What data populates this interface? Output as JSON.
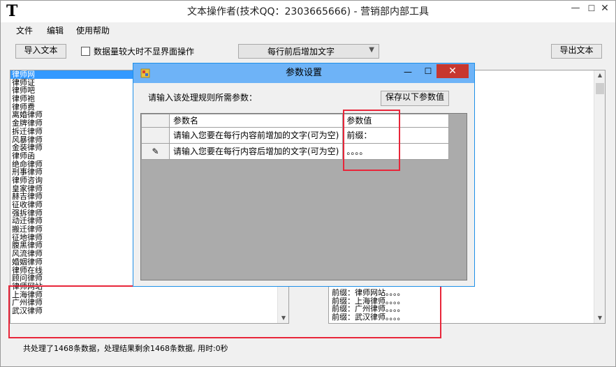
{
  "window": {
    "icon_glyph": "T",
    "title": "文本操作者(技术QQ：2303665666) - 营销部内部工具",
    "controls": {
      "minimize": "—",
      "maximize": "☐",
      "close": "✕"
    }
  },
  "menu": [
    "文件",
    "编辑",
    "使用帮助"
  ],
  "toolbar": {
    "import_label": "导入文本",
    "checkbox_label": "数据量较大时不显界面操作",
    "operation_selected": "每行前后增加文字",
    "export_label": "导出文本"
  },
  "left_list": {
    "items": [
      "律师网",
      "律师证",
      "律师吧",
      "律师袍",
      "律师费",
      "离婚律师",
      "金牌律师",
      "拆迁律师",
      "风暴律师",
      "金装律师",
      "律师函",
      "绝命律师",
      "刑事律师",
      "律师咨询",
      "皇家律师",
      "赫吉律师",
      "征收律师",
      "强拆律师",
      "动迁律师",
      "搬迁律师",
      "征地律师",
      "腹黑律师",
      "风流律师",
      "婚姻律师",
      "律师在线",
      "顾问律师"
    ],
    "highlighted_items": [
      "律师网站",
      "上海律师",
      "广州律师",
      "武汉律师"
    ]
  },
  "right_list": {
    "items": [
      "前缀：律师网站。。。。",
      "前缀：上海律师。。。。",
      "前缀：广州律师。。。。",
      "前缀：武汉律师。。。。"
    ]
  },
  "status": "共处理了1468条数据，处理结果剩余1468条数据, 用时:0秒",
  "dialog": {
    "title": "参数设置",
    "controls": {
      "minimize": "—",
      "maximize": "☐",
      "close": "✕"
    },
    "prompt": "请输入该处理规则所需参数：",
    "save_label": "保存以下参数值",
    "grid": {
      "headers": [
        "参数名",
        "参数值"
      ],
      "rows": [
        {
          "name": "请输入您要在每行内容前增加的文字(可为空)",
          "value": "前缀：",
          "row_marker": ""
        },
        {
          "name": "请输入您要在每行内容后增加的文字(可为空)",
          "value": "。。。。",
          "row_marker": "✎"
        }
      ]
    }
  },
  "colors": {
    "highlight_box": "#e8263a",
    "dialog_titlebar": "#6eb3f7",
    "close_button": "#c7372f",
    "selection": "#3399ff"
  }
}
